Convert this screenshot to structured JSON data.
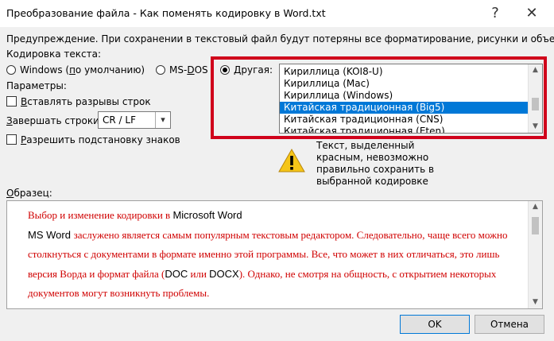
{
  "window": {
    "title": "Преобразование файла - Как поменять кодировку в Word.txt",
    "help_glyph": "?",
    "close_glyph": "✕"
  },
  "warning_text": "Предупреждение. При сохранении в текстовый файл будут потеряны все форматирование, рисунки и объекты.",
  "encoding": {
    "label": "Кодировка текста:",
    "options": [
      {
        "pre": "Windows (",
        "u": "п",
        "post": "о умолчанию)",
        "checked": false
      },
      {
        "pre": "MS-",
        "u": "D",
        "post": "OS",
        "checked": false
      },
      {
        "pre": "",
        "u": "Д",
        "post": "ругая:",
        "checked": true
      }
    ],
    "list": [
      "Кириллица (KOI8-U)",
      "Кириллица (Mac)",
      "Кириллица (Windows)",
      "Китайская традиционная (Big5)",
      "Китайская традиционная (CNS)",
      "Китайская традиционная (Eten)"
    ],
    "selected_index": 3
  },
  "params": {
    "label": "Параметры:",
    "insert_breaks": {
      "u": "В",
      "post": "ставлять разрывы строк"
    },
    "end_lines": {
      "pre": "",
      "u": "З",
      "post": "авершать строки:",
      "value": "CR / LF"
    },
    "allow_subst": {
      "u": "Р",
      "post": "азрешить подстановку знаков"
    }
  },
  "warning_msg": "Текст, выделенный красным, невозможно правильно сохранить в выбранной кодировке",
  "sample": {
    "label_u": "О",
    "label_post": "бразец:",
    "paragraphs": [
      [
        {
          "t": "Выбор и изменение кодировки в ",
          "c": "red"
        },
        {
          "t": "Microsoft Word",
          "c": "black"
        }
      ],
      [
        {
          "t": "MS Word ",
          "c": "black"
        },
        {
          "t": "заслужено является самым популярным текстовым редактором. Следовательно, чаще всего можно столкнуться с документами в формате именно этой программы. Все, что может в них отличаться, это лишь версия Ворда и формат файла (",
          "c": "red"
        },
        {
          "t": "DOC",
          "c": "black"
        },
        {
          "t": " или ",
          "c": "red"
        },
        {
          "t": "DOCX",
          "c": "black"
        },
        {
          "t": "). Однако, не смотря на общность, с открытием некоторых документов могут возникнуть проблемы.",
          "c": "red"
        }
      ]
    ]
  },
  "buttons": {
    "ok": "OK",
    "cancel": "Отмена"
  },
  "colors": {
    "highlight": "#d0021b",
    "selection": "#0078d7",
    "unsupported_text": "#d00000"
  }
}
